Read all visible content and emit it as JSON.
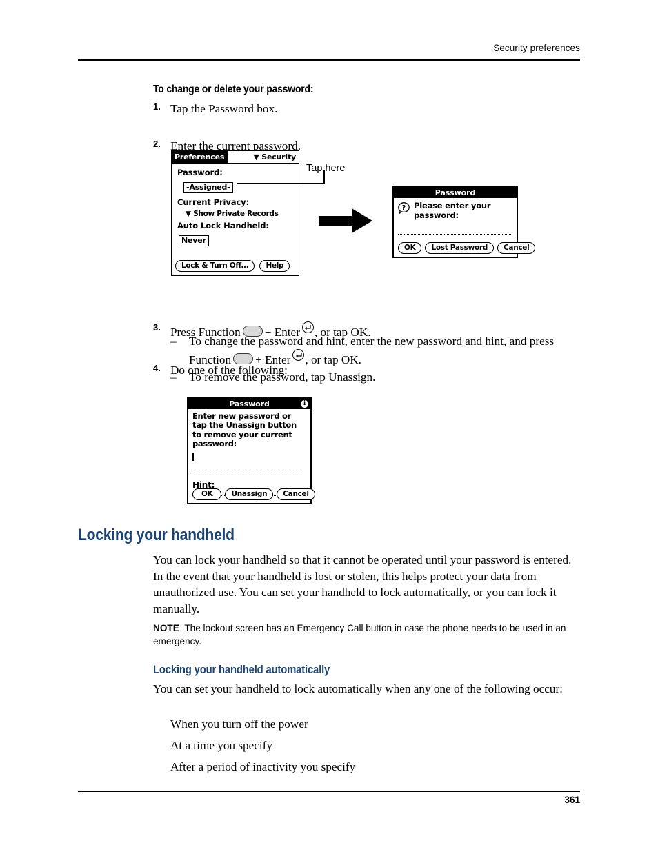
{
  "header": {
    "running_head": "Security preferences"
  },
  "footer": {
    "page_number": "361"
  },
  "procedure": {
    "heading": "To change or delete your password:",
    "steps": [
      {
        "num": "1.",
        "text": "Tap the Password box."
      },
      {
        "num": "2.",
        "text": "Enter the current password."
      }
    ],
    "step3": {
      "num": "3.",
      "text_before": "Press Function",
      "text_middle": "+ Enter",
      "text_after": ", or tap OK."
    },
    "step4": {
      "num": "4.",
      "text": "Do one of the following:"
    },
    "bullets": [
      {
        "dash": "–",
        "text_before": "To change the password and hint, enter the new password and hint, and press Function",
        "text_middle": "+ Enter",
        "text_after": ", or tap OK."
      },
      {
        "dash": "–",
        "text": "To remove the password, tap Unassign."
      }
    ]
  },
  "callout": {
    "tap_here": "Tap here"
  },
  "prefs_screen": {
    "tab_title": "Preferences",
    "category_arrow": "▼",
    "category": "Security",
    "password_label": "Password:",
    "password_value": "-Assigned-",
    "privacy_label": "Current Privacy:",
    "privacy_arrow": "▼",
    "privacy_value": "Show Private Records",
    "autolock_label": "Auto Lock Handheld:",
    "autolock_value": "Never",
    "lock_button": "Lock & Turn Off...",
    "help_button": "Help"
  },
  "password_enter_dialog": {
    "title": "Password",
    "icon": "question-mark-icon",
    "message": "Please enter your password:",
    "buttons": [
      "OK",
      "Lost Password",
      "Cancel"
    ]
  },
  "password_new_dialog": {
    "title": "Password",
    "info_icon": "i",
    "message": "Enter new password or tap the Unassign button to remove your current password:",
    "hint_label": "Hint:",
    "buttons": [
      "OK",
      "Unassign",
      "Cancel"
    ]
  },
  "section": {
    "heading": "Locking your handheld",
    "paragraph": "You can lock your handheld so that it cannot be operated until your password is entered. In the event that your handheld is lost or stolen, this helps protect your data from unauthorized use. You can set your handheld to lock automatically, or you can lock it manually.",
    "note_label": "NOTE",
    "note_text": "The lockout screen has an Emergency Call button in case the phone needs to be used in an emergency."
  },
  "subsection": {
    "heading": "Locking your handheld automatically",
    "paragraph": "You can set your handheld to lock automatically when any one of the following occur:",
    "items": [
      "When you turn off the power",
      "At a time you specify",
      "After a period of inactivity you specify"
    ]
  },
  "colors": {
    "heading_blue": "#1d4471",
    "text_black": "#000000",
    "fn_key_gray": "#d9d9d9"
  }
}
